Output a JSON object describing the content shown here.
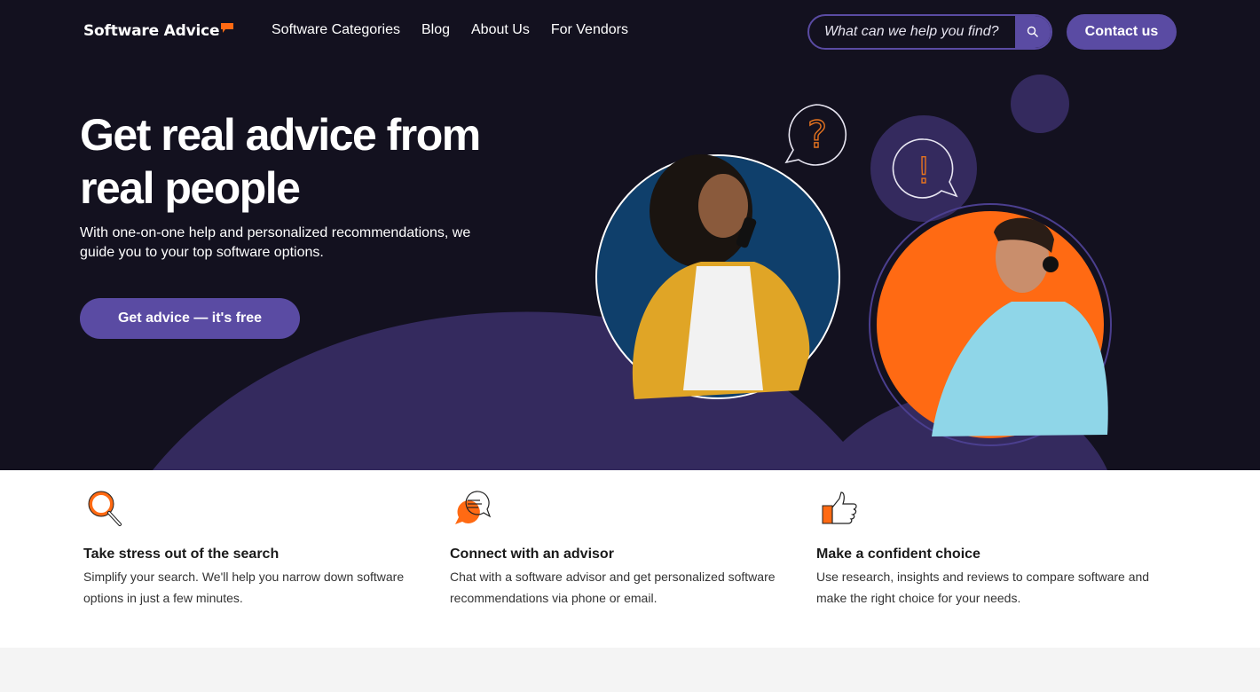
{
  "header": {
    "logo": "Software Advice",
    "nav": [
      "Software Categories",
      "Blog",
      "About Us",
      "For Vendors"
    ],
    "search_placeholder": "What can we help you find?",
    "search_icon": "search-icon",
    "contact_label": "Contact us"
  },
  "hero": {
    "title": "Get real advice from real people",
    "subtitle": "With one-on-one help and personalized recommendations, we guide you to your top software options.",
    "cta_label": "Get advice — it's free",
    "illustration": {
      "left_person": "woman in yellow cardigan on phone",
      "right_person": "man with headset in blue shirt",
      "bubble_left_glyph": "?",
      "bubble_right_glyph": "!"
    }
  },
  "features": [
    {
      "icon": "magnifier-icon",
      "title": "Take stress out of the search",
      "text": "Simplify your search. We'll help you narrow down software options in just a few minutes."
    },
    {
      "icon": "chat-bubbles-icon",
      "title": "Connect with an advisor",
      "text": "Chat with a software advisor and get personalized software recommendations via phone or email."
    },
    {
      "icon": "thumbs-up-icon",
      "title": "Make a confident choice",
      "text": "Use research, insights and reviews to compare software and make the right choice for your needs."
    }
  ],
  "colors": {
    "hero_bg": "#13111f",
    "accent_purple": "#5a4ba3",
    "hill_purple": "#342a5e",
    "brand_orange": "#ff6a13",
    "woman_bg": "#0f3f6b"
  }
}
